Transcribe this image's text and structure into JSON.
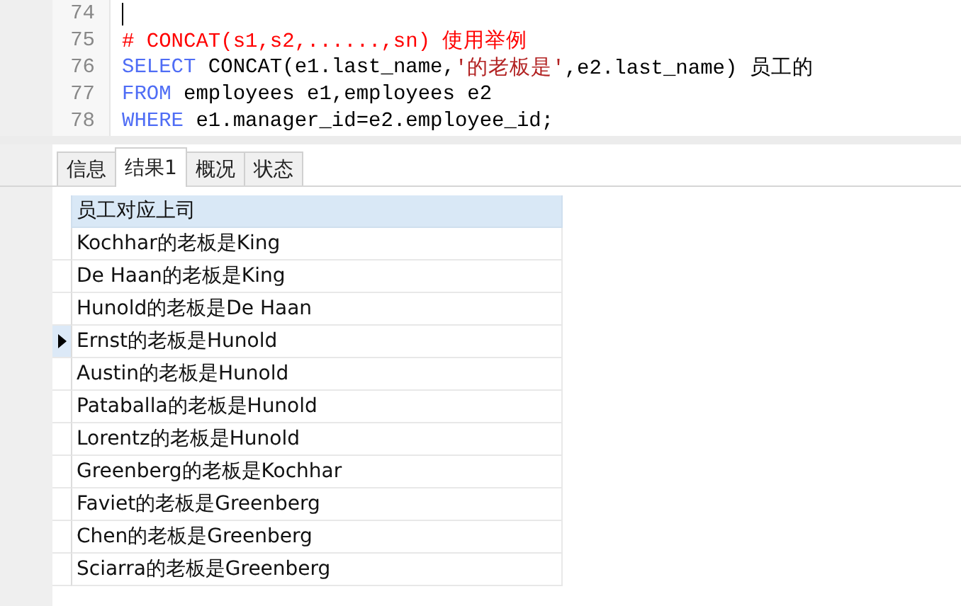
{
  "editor": {
    "lines": [
      {
        "number": "74",
        "caret": true
      },
      {
        "number": "75",
        "caret": false,
        "tokens": [
          {
            "kind": "comment",
            "text": "# CONCAT(s1,s2,......,sn) 使用举例"
          }
        ]
      },
      {
        "number": "76",
        "caret": false,
        "tokens": [
          {
            "kind": "keyword",
            "text": "SELECT"
          },
          {
            "kind": "plain",
            "text": " CONCAT(e1.last_name,"
          },
          {
            "kind": "string",
            "text": "'的老板是'"
          },
          {
            "kind": "plain",
            "text": ",e2.last_name) 员工的"
          }
        ]
      },
      {
        "number": "77",
        "caret": false,
        "tokens": [
          {
            "kind": "keyword",
            "text": "FROM"
          },
          {
            "kind": "plain",
            "text": " employees e1,employees e2"
          }
        ]
      },
      {
        "number": "78",
        "caret": false,
        "tokens": [
          {
            "kind": "keyword",
            "text": "WHERE"
          },
          {
            "kind": "plain",
            "text": " e1.manager_id=e2.employee_id;"
          }
        ]
      }
    ]
  },
  "tabs": [
    {
      "label": "信息",
      "selected": false
    },
    {
      "label": "结果1",
      "selected": true
    },
    {
      "label": "概况",
      "selected": false
    },
    {
      "label": "状态",
      "selected": false
    }
  ],
  "table": {
    "columns": [
      "员工对应上司"
    ],
    "rows": [
      {
        "cells": [
          "Kochhar的老板是King"
        ],
        "selected": false
      },
      {
        "cells": [
          "De Haan的老板是King"
        ],
        "selected": false
      },
      {
        "cells": [
          "Hunold的老板是De Haan"
        ],
        "selected": false
      },
      {
        "cells": [
          "Ernst的老板是Hunold"
        ],
        "selected": true
      },
      {
        "cells": [
          "Austin的老板是Hunold"
        ],
        "selected": false
      },
      {
        "cells": [
          "Pataballa的老板是Hunold"
        ],
        "selected": false
      },
      {
        "cells": [
          "Lorentz的老板是Hunold"
        ],
        "selected": false
      },
      {
        "cells": [
          "Greenberg的老板是Kochhar"
        ],
        "selected": false
      },
      {
        "cells": [
          "Faviet的老板是Greenberg"
        ],
        "selected": false
      },
      {
        "cells": [
          "Chen的老板是Greenberg"
        ],
        "selected": false
      },
      {
        "cells": [
          "Sciarra的老板是Greenberg"
        ],
        "selected": false
      }
    ]
  }
}
